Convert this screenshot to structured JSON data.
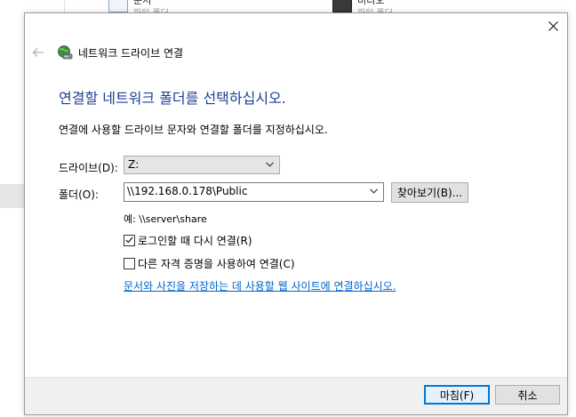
{
  "background_window": {
    "items": [
      {
        "title": "문서",
        "subtitle": "파일 폴더"
      },
      {
        "title": "비디오",
        "subtitle": "파일 폴더"
      }
    ]
  },
  "dialog": {
    "title": "네트워크 드라이브 연결",
    "heading": "연결할 네트워크 폴더를 선택하십시오.",
    "description": "연결에 사용할 드라이브 문자와 연결할 폴더를 지정하십시오.",
    "drive_label": "드라이브(D):",
    "drive_value": "Z:",
    "folder_label": "폴더(O):",
    "folder_value": "\\\\192.168.0.178\\Public",
    "browse_label": "찾아보기(B)...",
    "example": "예: \\\\server\\share",
    "reconnect_label": "로그인할 때 다시 연결(R)",
    "reconnect_checked": true,
    "credentials_label": "다른 자격 증명을 사용하여 연결(C)",
    "credentials_checked": false,
    "link_text": "문서와 사진을 저장하는 데 사용할 웹 사이트에 연결하십시오.",
    "finish_label": "마침(F)",
    "cancel_label": "취소"
  },
  "colors": {
    "heading": "#1c3f94",
    "link": "#0066cc",
    "default_button_border": "#0078d7"
  }
}
